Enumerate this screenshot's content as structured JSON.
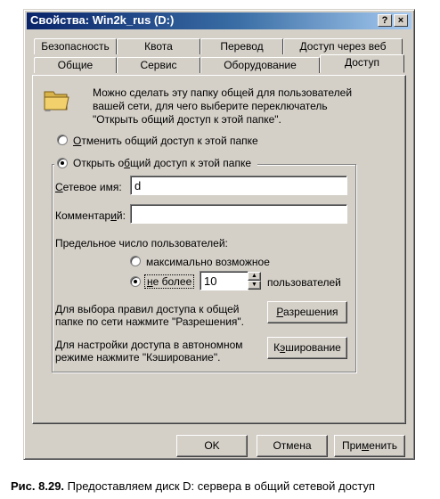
{
  "window": {
    "title": "Свойства: Win2k_rus (D:)",
    "help_button": "?",
    "close_button": "×"
  },
  "tabs_back": [
    "Безопасность",
    "Квота",
    "Перевод",
    "Доступ через веб"
  ],
  "tabs_front": [
    "Общие",
    "Сервис",
    "Оборудование",
    "Доступ"
  ],
  "active_tab": "Доступ",
  "info_text": [
    "Можно сделать эту папку общей для пользователей",
    "вашей сети, для чего выберите переключатель",
    "\"Открыть общий доступ к этой папке\"."
  ],
  "radio_unshare": {
    "label": "Отменить общий доступ к этой папке",
    "checked": false
  },
  "radio_share": {
    "label": "Открыть общий доступ к этой папке",
    "checked": true
  },
  "share_name": {
    "label": "Сетевое имя:",
    "value": "d"
  },
  "comment": {
    "label": "Комментарий:",
    "value": ""
  },
  "user_limit": {
    "label": "Предельное число пользователей:",
    "max_option": {
      "label": "максимально возможное",
      "checked": false
    },
    "limit_option": {
      "label": "не более",
      "checked": true
    },
    "value": "10",
    "suffix": "пользователей"
  },
  "permissions": {
    "text": [
      "Для выбора правил доступа к общей",
      "папке по сети нажмите \"Разрешения\"."
    ],
    "button": "Разрешения"
  },
  "caching": {
    "text": [
      "Для настройки доступа в автономном",
      "режиме нажмите \"Кэширование\"."
    ],
    "button": "Кэширование"
  },
  "footer": {
    "ok": "OK",
    "cancel": "Отмена",
    "apply": "Применить"
  },
  "caption": {
    "prefix": "Рис. 8.29.",
    "text": " Предоставляем диск D: сервера в общий сетевой доступ"
  },
  "colors": {
    "face": "#d4d0c8",
    "title_start": "#0a246a",
    "title_end": "#a6caf0",
    "folder": "#f2d06b"
  }
}
